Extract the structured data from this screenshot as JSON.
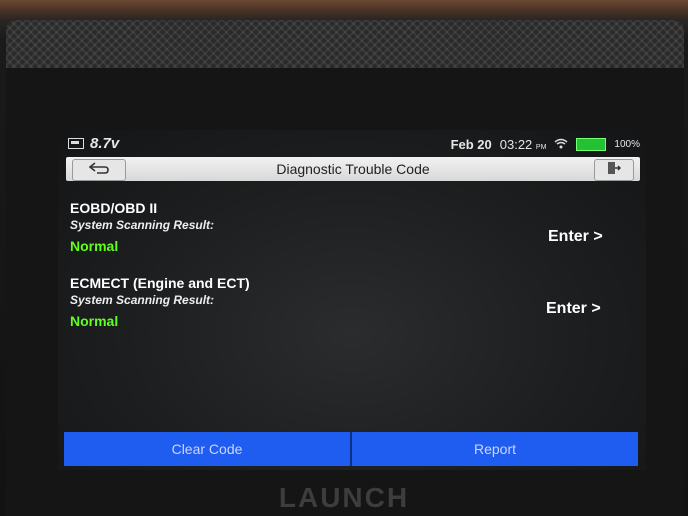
{
  "status_bar": {
    "voltage": "8.7v",
    "date": "Feb 20",
    "time": "03:22",
    "ampm": "PM",
    "battery": "100%"
  },
  "header": {
    "title": "Diagnostic Trouble Code"
  },
  "systems": [
    {
      "name": "EOBD/OBD II",
      "label": "System Scanning Result:",
      "status": "Normal",
      "action": "Enter >"
    },
    {
      "name": "ECMECT (Engine and ECT)",
      "label": "System Scanning Result:",
      "status": "Normal",
      "action": "Enter >"
    }
  ],
  "buttons": {
    "clear": "Clear Code",
    "report": "Report"
  },
  "brand": "LAUNCH",
  "colors": {
    "accent_blue": "#1f5cf0",
    "status_green": "#63ff1c",
    "battery_green": "#23c232"
  }
}
